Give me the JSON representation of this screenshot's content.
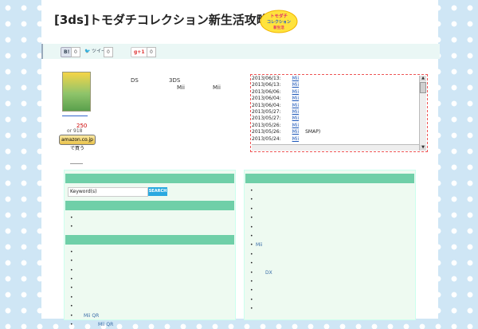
{
  "site": {
    "title": "[3ds]トモダチコレクション新生活攻略広場"
  },
  "logo": {
    "line1": "トモダチ",
    "line2": "コレクション",
    "line3": "新生活"
  },
  "share": {
    "hatena_label": "B!",
    "hatena_count": "0",
    "tweet_label": "ツイート",
    "tweet_count": "0",
    "gplus_label": "g+1",
    "gplus_count": "0"
  },
  "product": {
    "price": "250",
    "price_sub": "or 918",
    "amazon_label": "amazon.co.jp で買う"
  },
  "intro": {
    "t1": "DS",
    "t2": "3DS",
    "t3": "Mii",
    "t4": "Mii"
  },
  "news": [
    {
      "date": "2013/06/13:",
      "link": "Mii",
      "tail": ""
    },
    {
      "date": "2013/06/13:",
      "link": "Mii",
      "tail": ""
    },
    {
      "date": "2013/06/06:",
      "link": "Mii",
      "tail": ""
    },
    {
      "date": "2013/06/04:",
      "link": "Mii",
      "tail": ""
    },
    {
      "date": "2013/06/04:",
      "link": "Mii",
      "tail": ""
    },
    {
      "date": "2013/05/27:",
      "link": "Mii",
      "tail": ""
    },
    {
      "date": "2013/05/27:",
      "link": "Mii",
      "tail": ""
    },
    {
      "date": "2013/05/26:",
      "link": "Mii",
      "tail": ""
    },
    {
      "date": "2013/05/26:",
      "link": "Mii",
      "tail": "SMAP)"
    },
    {
      "date": "2013/05/24:",
      "link": "Mii",
      "tail": ""
    }
  ],
  "search": {
    "value": "Keyword(s)",
    "button": "SEARCH"
  },
  "left_list1": [
    {
      "text": ""
    },
    {
      "text": ""
    }
  ],
  "left_list2": [
    {
      "text": ""
    },
    {
      "text": ""
    },
    {
      "text": ""
    },
    {
      "text": ""
    },
    {
      "text": ""
    },
    {
      "text": ""
    },
    {
      "text": ""
    },
    {
      "text": "Mii QR"
    },
    {
      "text": "Mii QR"
    }
  ],
  "right_list": [
    {
      "text": ""
    },
    {
      "text": ""
    },
    {
      "text": ""
    },
    {
      "text": ""
    },
    {
      "text": ""
    },
    {
      "text": ""
    },
    {
      "text": "Mii"
    },
    {
      "text": ""
    },
    {
      "text": ""
    },
    {
      "text": "DX"
    },
    {
      "text": ""
    },
    {
      "text": ""
    },
    {
      "text": ""
    },
    {
      "text": ""
    }
  ],
  "colors": {
    "accent": "#6fcfa8",
    "link": "#1a55b8",
    "bg": "#cfe6f5",
    "search_button": "#2aa9e0"
  }
}
